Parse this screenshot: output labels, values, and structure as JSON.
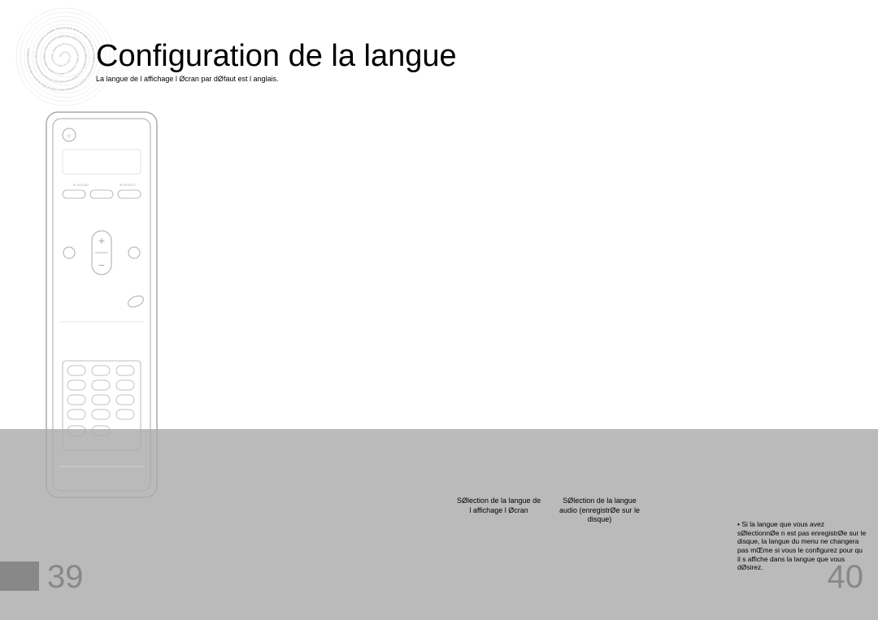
{
  "header": {
    "title": "Configuration de la langue",
    "subtitle": "La langue de l affichage l Øcran par dØfaut est l anglais."
  },
  "captions": {
    "caption1_line1": "SØlection de la langue de",
    "caption1_line2": "l affichage l Øcran",
    "caption2_line1": "SØlection de la langue",
    "caption2_line2": "audio (enregistrØe sur le",
    "caption2_line3": "disque)"
  },
  "note": {
    "bullet": "•",
    "text": "Si la langue que vous avez sØlectionnØe n est pas enregistrØe sur le disque, la langue du menu ne changera pas mŒme si vous le configurez pour qu il s affiche dans la langue que vous dØsirez."
  },
  "page_numbers": {
    "left": "39",
    "right": "40"
  }
}
